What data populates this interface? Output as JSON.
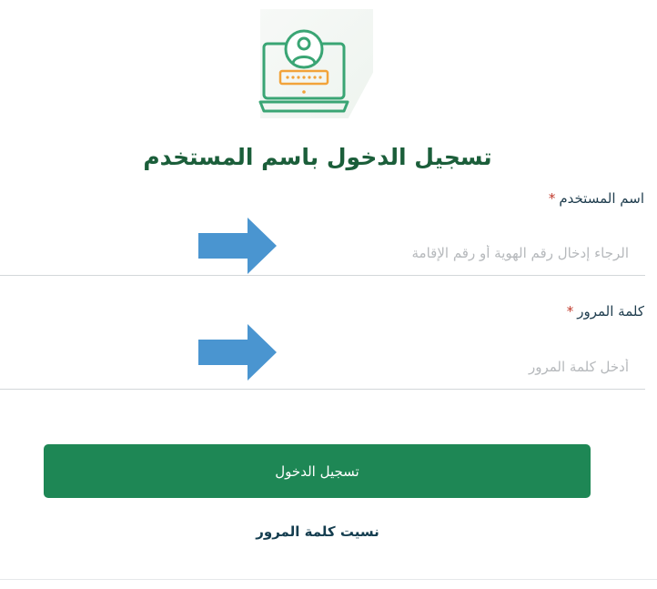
{
  "header": {
    "title": "تسجيل الدخول باسم المستخدم",
    "logo_icon": "user-login-laptop-icon"
  },
  "form": {
    "username": {
      "label": "اسم المستخدم",
      "required_mark": "*",
      "placeholder": "الرجاء إدخال رقم الهوية أو رقم الإقامة",
      "value": ""
    },
    "password": {
      "label": "كلمة المرور",
      "required_mark": "*",
      "placeholder": "أدخل كلمة المرور",
      "value": ""
    },
    "submit_label": "تسجيل الدخول",
    "forgot_label": "نسيت كلمة المرور"
  },
  "annotations": {
    "arrow_icon": "right-arrow-icon",
    "arrow_color": "#4a95d0"
  },
  "colors": {
    "brand_green": "#1e8755",
    "title_green": "#1b5e3a",
    "icon_green": "#3aa574",
    "icon_orange": "#f2a33a",
    "required_red": "#c0392b"
  }
}
